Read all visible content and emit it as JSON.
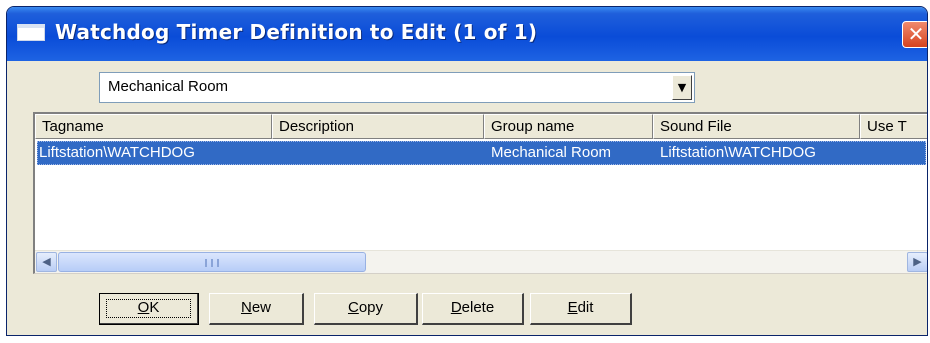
{
  "window": {
    "title": "Watchdog Timer Definition to Edit (1 of 1)",
    "close_glyph": "✕",
    "icon": "window-icon"
  },
  "group_select": {
    "value": "Mechanical Room",
    "arrow": "▼"
  },
  "list": {
    "columns": [
      "Tagname",
      "Description",
      "Group name",
      "Sound File",
      "Use T"
    ],
    "rows": [
      {
        "tagname": "Liftstation\\WATCHDOG",
        "description": "",
        "group_name": "Mechanical Room",
        "sound_file": "Liftstation\\WATCHDOG",
        "selected": true
      }
    ],
    "scroll_left": "◀",
    "scroll_right": "▶"
  },
  "buttons": {
    "ok": {
      "accel": "O",
      "rest": "K"
    },
    "new": {
      "accel": "N",
      "rest": "ew"
    },
    "copy": {
      "accel": "C",
      "rest": "opy"
    },
    "delete": {
      "accel": "D",
      "rest": "elete"
    },
    "edit": {
      "accel": "E",
      "rest": "dit"
    }
  },
  "colors": {
    "titlebar": "#0a4cd8",
    "selection": "#316ac5",
    "close_button": "#d6431f",
    "dialog_face": "#ece9d8"
  }
}
